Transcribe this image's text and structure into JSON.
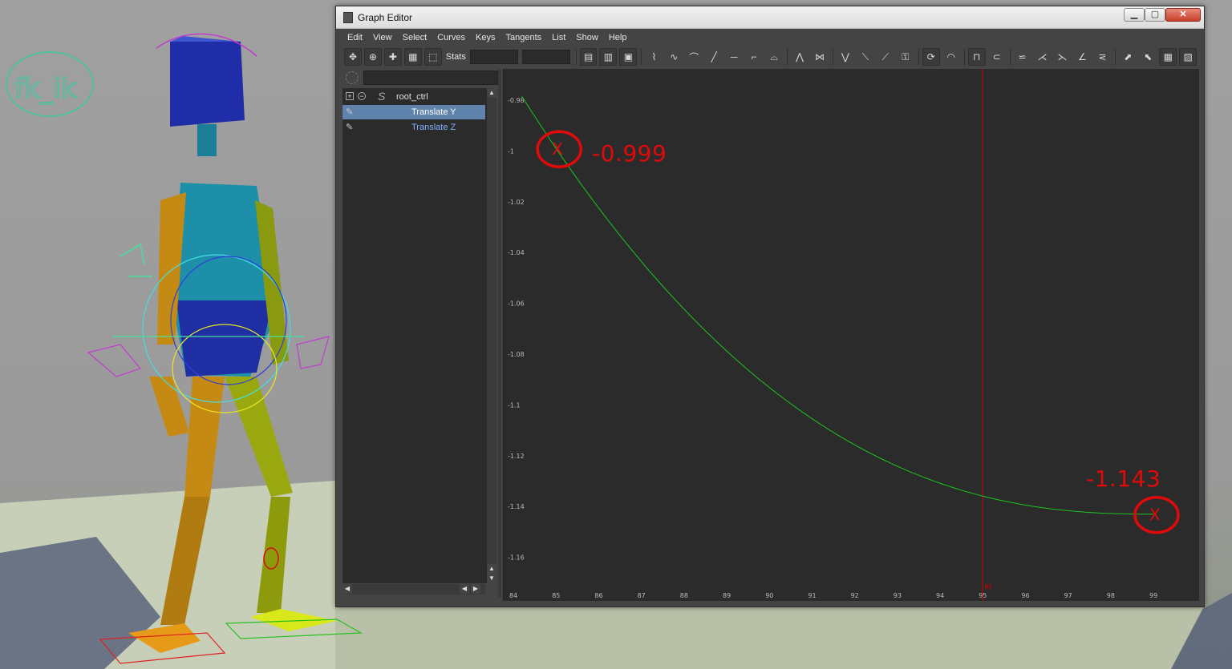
{
  "viewport": {
    "rig_label": "fk_ik"
  },
  "window": {
    "title": "Graph Editor",
    "min_label": "▁",
    "max_label": "▢",
    "close_label": "✕"
  },
  "menu": [
    "Edit",
    "View",
    "Select",
    "Curves",
    "Keys",
    "Tangents",
    "List",
    "Show",
    "Help"
  ],
  "toolbar": {
    "stats_label": "Stats"
  },
  "outliner": {
    "root": "root_ctrl",
    "expand_glyph": "+",
    "collapse_glyph": "−",
    "curve_glyph": "S",
    "pin_glyph": "✎",
    "attributes": [
      "Translate Y",
      "Translate Z"
    ],
    "selected_attribute": "Translate Y"
  },
  "graph": {
    "y_ticks": [
      "-0.98",
      "-1",
      "-1.02",
      "-1.04",
      "-1.06",
      "-1.08",
      "-1.1",
      "-1.12",
      "-1.14",
      "-1.16"
    ],
    "x_ticks": [
      "84",
      "85",
      "86",
      "87",
      "88",
      "89",
      "90",
      "91",
      "92",
      "93",
      "94",
      "95",
      "96",
      "97",
      "98",
      "99"
    ],
    "current_frame": "95",
    "curve_color": "#1ec41e",
    "time_marker_color": "#d40000",
    "keys": [
      {
        "frame": 85,
        "value": -0.999
      },
      {
        "frame": 99,
        "value": -1.143
      }
    ]
  },
  "annotations": {
    "start_value": "-0.999",
    "end_value": "-1.143",
    "key_mark": "X",
    "color": "#e10a0a"
  }
}
